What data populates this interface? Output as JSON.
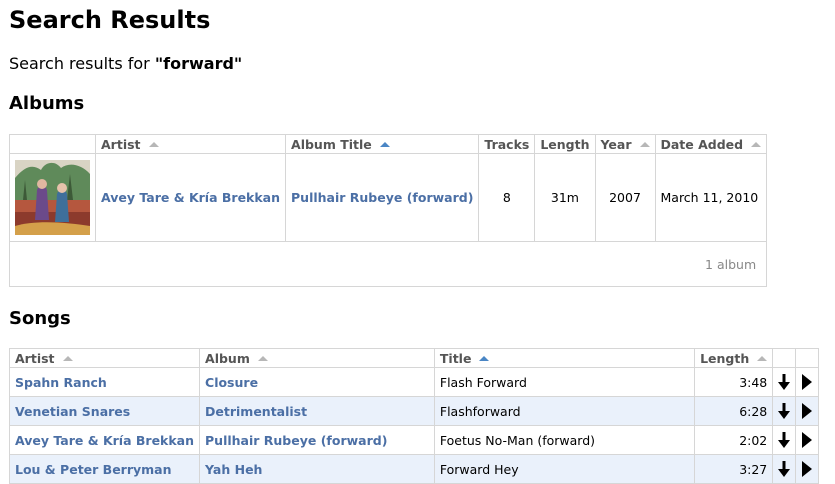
{
  "page": {
    "title": "Search Results",
    "subtitle_prefix": "Search results for ",
    "query": "\"forward\""
  },
  "albums": {
    "heading": "Albums",
    "columns": [
      "Artist",
      "Album Title",
      "Tracks",
      "Length",
      "Year",
      "Date Added"
    ],
    "rows": [
      {
        "artist": "Avey Tare & Kría Brekkan",
        "title": "Pullhair Rubeye (forward)",
        "tracks": "8",
        "length": "31m",
        "year": "2007",
        "date_added": "March 11, 2010"
      }
    ],
    "count_label": "1 album"
  },
  "songs": {
    "heading": "Songs",
    "columns": [
      "Artist",
      "Album",
      "Title",
      "Length"
    ],
    "rows": [
      {
        "artist": "Spahn Ranch",
        "album": "Closure",
        "title": "Flash Forward",
        "length": "3:48"
      },
      {
        "artist": "Venetian Snares",
        "album": "Detrimentalist",
        "title": "Flashforward",
        "length": "6:28"
      },
      {
        "artist": "Avey Tare & Kría Brekkan",
        "album": "Pullhair Rubeye (forward)",
        "title": "Foetus No-Man (forward)",
        "length": "2:02"
      },
      {
        "artist": "Lou & Peter Berryman",
        "album": "Yah Heh",
        "title": "Forward Hey",
        "length": "3:27"
      }
    ]
  },
  "colors": {
    "link": "#4b6fa5",
    "row_alt": "#eaf1fb",
    "sort_active": "#4a86c5"
  }
}
